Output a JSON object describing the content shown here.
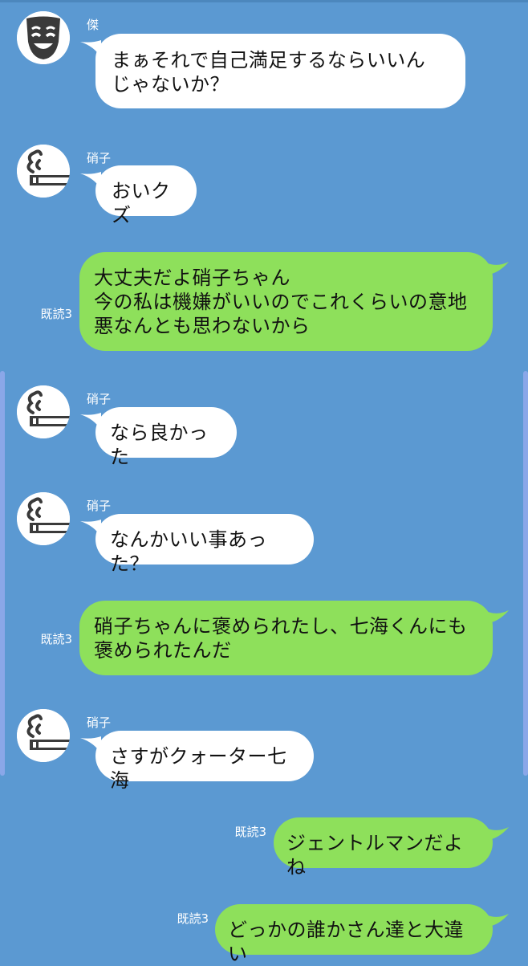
{
  "messages": [
    {
      "side": "left",
      "sender": "傑",
      "avatar": "smiling-mask-icon",
      "text": "まぁそれで自己満足するならいいん\nじゃないか？"
    },
    {
      "side": "left",
      "sender": "硝子",
      "avatar": "smoking-cigarette-icon",
      "text": "おいクズ"
    },
    {
      "side": "right",
      "read": "既読3",
      "text": "大丈夫だよ硝子ちゃん\n今の私は機嫌がいいのでこれくらいの意地\n悪なんとも思わないから"
    },
    {
      "side": "left",
      "sender": "硝子",
      "avatar": "smoking-cigarette-icon",
      "text": "なら良かった"
    },
    {
      "side": "left",
      "sender": "硝子",
      "avatar": "smoking-cigarette-icon",
      "text": "なんかいい事あった？"
    },
    {
      "side": "right",
      "read": "既読3",
      "text": "硝子ちゃんに褒められたし、七海くんにも\n褒められたんだ"
    },
    {
      "side": "left",
      "sender": "硝子",
      "avatar": "smoking-cigarette-icon",
      "text": "さすがクォーター七海"
    },
    {
      "side": "right",
      "read": "既読3",
      "text": "ジェントルマンだよね"
    },
    {
      "side": "right",
      "read": "既読3",
      "text": "どっかの誰かさん達と大違い"
    }
  ],
  "colors": {
    "background": "#5b99d2",
    "incoming_bubble": "#ffffff",
    "outgoing_bubble": "#8ee05b",
    "meta_text": "#ffffff"
  }
}
